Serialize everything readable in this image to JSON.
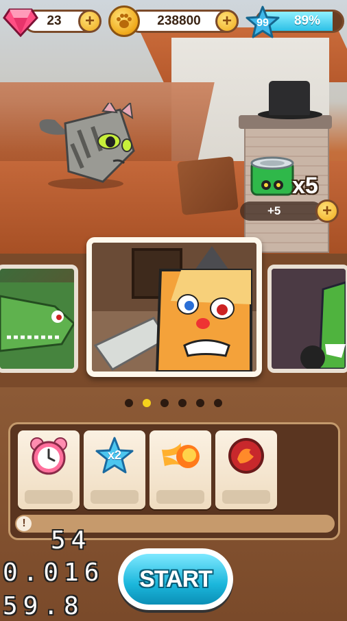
{
  "hud": {
    "gems": "23",
    "coins": "238800",
    "energy_level": "99",
    "energy_percent": "89%",
    "energy_fill": 0.89
  },
  "food": {
    "multiplier": "x5",
    "bonus": "+5"
  },
  "carousel": {
    "pages": 6,
    "active_page": 2
  },
  "powerups": [
    {
      "icon": "alarm-clock-icon",
      "label": ""
    },
    {
      "icon": "x2-star-icon",
      "label": "x2"
    },
    {
      "icon": "fireball-icon",
      "label": ""
    },
    {
      "icon": "red-orb-icon",
      "label": ""
    }
  ],
  "debug_stats": [
    "54",
    "0.016",
    "59.8"
  ],
  "start_label": "START",
  "colors": {
    "accent_blue": "#1bb7dc",
    "gold": "#f0a91a",
    "panel_brown": "#5a3520"
  }
}
